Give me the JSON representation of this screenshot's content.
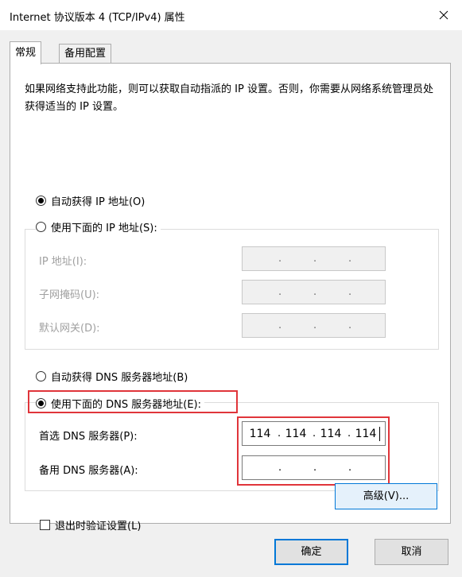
{
  "window": {
    "title": "Internet 协议版本 4 (TCP/IPv4) 属性"
  },
  "tabs": [
    {
      "label": "常规",
      "active": true
    },
    {
      "label": "备用配置",
      "active": false
    }
  ],
  "description": "如果网络支持此功能，则可以获取自动指派的 IP 设置。否则，你需要从网络系统管理员处获得适当的 IP 设置。",
  "ip_section": {
    "auto_label": "自动获得 IP 地址(O)",
    "auto_checked": true,
    "manual_label": "使用下面的 IP 地址(S):",
    "manual_checked": false,
    "fields": [
      {
        "label": "IP 地址(I):"
      },
      {
        "label": "子网掩码(U):"
      },
      {
        "label": "默认网关(D):"
      }
    ]
  },
  "dns_section": {
    "auto_label": "自动获得 DNS 服务器地址(B)",
    "auto_checked": false,
    "manual_label": "使用下面的 DNS 服务器地址(E):",
    "manual_checked": true,
    "preferred_label": "首选 DNS 服务器(P):",
    "preferred_value": [
      "114",
      "114",
      "114",
      "114"
    ],
    "alternate_label": "备用 DNS 服务器(A):",
    "alternate_value": [
      "",
      "",
      "",
      ""
    ]
  },
  "validate_on_exit_label": "退出时验证设置(L)",
  "validate_on_exit_checked": false,
  "buttons": {
    "advanced": "高级(V)...",
    "ok": "确定",
    "cancel": "取消"
  },
  "colors": {
    "highlight": "#e0353a",
    "accent": "#0078d7"
  }
}
